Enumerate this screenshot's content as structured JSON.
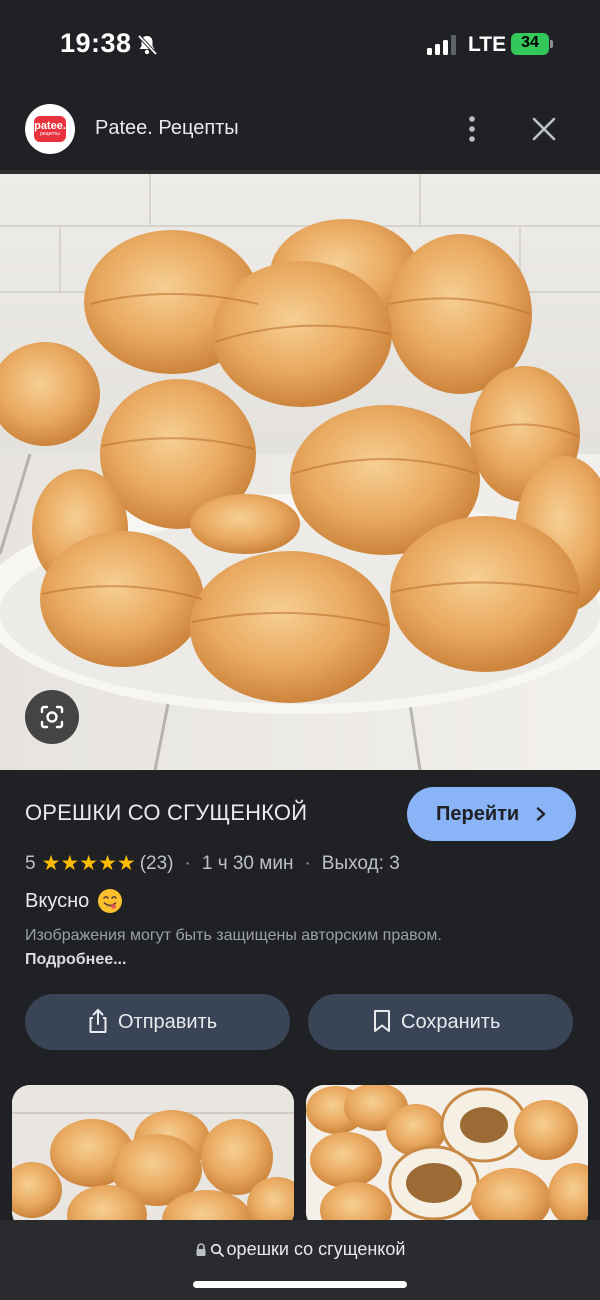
{
  "status_bar": {
    "time": "19:38",
    "network": "LTE",
    "battery": "34"
  },
  "header": {
    "source_logo_text": "patee.",
    "source_logo_subtext": "рецепты",
    "source_name": "Patee. Рецепты"
  },
  "recipe": {
    "title": "ОРЕШКИ СО СГУЩЕНКОЙ",
    "go_button": "Перейти",
    "rating": "5",
    "review_count": "(23)",
    "duration": "1 ч 30 мин",
    "yield": "Выход: 3",
    "review_text": "Вкусно",
    "copyright": "Изображения могут быть защищены авторским правом.",
    "more_link": "Подробнее...",
    "share_button": "Отправить",
    "save_button": "Сохранить"
  },
  "bottom_bar": {
    "url_text": "орешки со сгущенкой"
  },
  "colors": {
    "background": "#202124",
    "accent": "#8ab4f8",
    "star": "#fbbc04",
    "action_button": "#394457"
  },
  "icons": [
    "bell-off-icon",
    "signal-icon",
    "battery-icon",
    "more-vertical-icon",
    "close-icon",
    "lens-icon",
    "chevron-right-icon",
    "star-icon",
    "share-icon",
    "bookmark-icon",
    "lock-icon",
    "search-icon"
  ]
}
